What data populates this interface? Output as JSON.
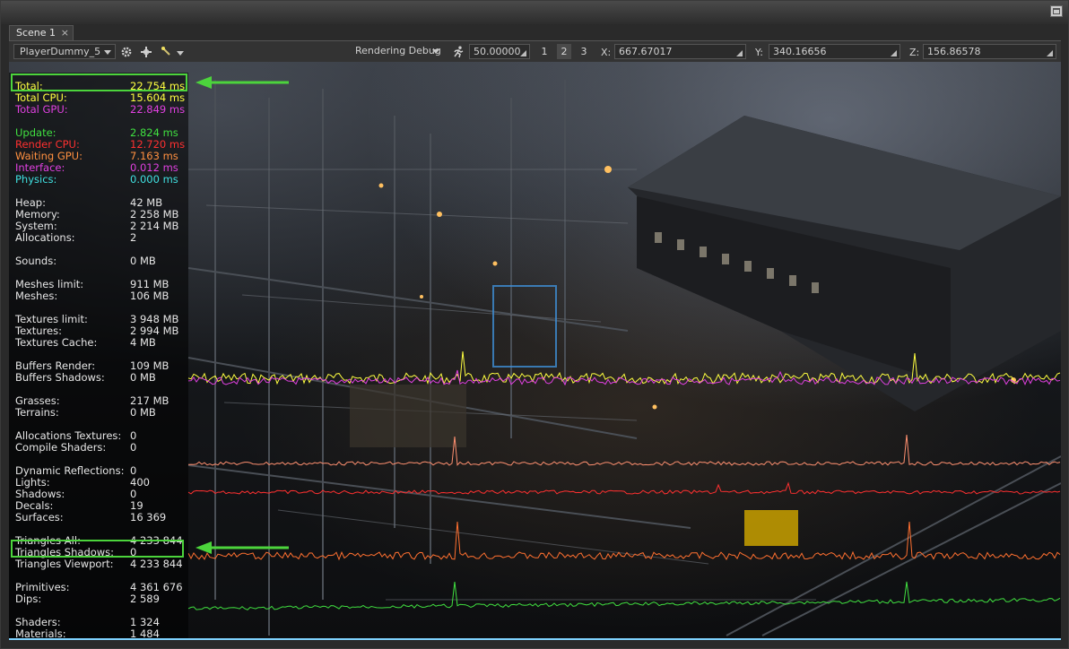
{
  "tab": {
    "label": "Scene 1",
    "close": "×"
  },
  "toolbar": {
    "camera_combo": "PlayerDummy_5",
    "mode_combo": "Rendering Debug",
    "speed_value": "50.00000",
    "view_buttons": [
      "1",
      "2",
      "3"
    ],
    "x_label": "X:",
    "x_value": "667.67017",
    "y_label": "Y:",
    "y_value": "340.16656",
    "z_label": "Z:",
    "z_value": "156.86578"
  },
  "stats": [
    {
      "label": "Total:",
      "value": "22.754 ms",
      "color": "#ffff40"
    },
    {
      "label": "Total CPU:",
      "value": "15.604 ms",
      "color": "#ffff40"
    },
    {
      "label": "Total GPU:",
      "value": "22.849 ms",
      "color": "#e040e0"
    },
    {
      "label": "Update:",
      "value": "2.824 ms",
      "color": "#40e040"
    },
    {
      "label": "Render CPU:",
      "value": "12.720 ms",
      "color": "#ff3030"
    },
    {
      "label": "Waiting GPU:",
      "value": "7.163 ms",
      "color": "#ff9040"
    },
    {
      "label": "Interface:",
      "value": "0.012 ms",
      "color": "#e040e0"
    },
    {
      "label": "Physics:",
      "value": "0.000 ms",
      "color": "#40e0e0"
    },
    {
      "label": "Heap:",
      "value": "42 MB",
      "color": "#e6e6e6"
    },
    {
      "label": "Memory:",
      "value": "2 258 MB",
      "color": "#e6e6e6"
    },
    {
      "label": "System:",
      "value": "2 214 MB",
      "color": "#e6e6e6"
    },
    {
      "label": "Allocations:",
      "value": "2",
      "color": "#e6e6e6"
    },
    {
      "label": "Sounds:",
      "value": "0 MB",
      "color": "#e6e6e6"
    },
    {
      "label": "Meshes limit:",
      "value": "911 MB",
      "color": "#e6e6e6"
    },
    {
      "label": "Meshes:",
      "value": "106 MB",
      "color": "#e6e6e6"
    },
    {
      "label": "Textures limit:",
      "value": "3 948 MB",
      "color": "#e6e6e6"
    },
    {
      "label": "Textures:",
      "value": "2 994 MB",
      "color": "#e6e6e6"
    },
    {
      "label": "Textures Cache:",
      "value": "4 MB",
      "color": "#e6e6e6"
    },
    {
      "label": "Buffers Render:",
      "value": "109 MB",
      "color": "#e6e6e6"
    },
    {
      "label": "Buffers Shadows:",
      "value": "0 MB",
      "color": "#e6e6e6"
    },
    {
      "label": "Grasses:",
      "value": "217 MB",
      "color": "#e6e6e6"
    },
    {
      "label": "Terrains:",
      "value": "0 MB",
      "color": "#e6e6e6"
    },
    {
      "label": "Allocations Textures:",
      "value": "0",
      "color": "#e6e6e6"
    },
    {
      "label": "Compile Shaders:",
      "value": "0",
      "color": "#e6e6e6"
    },
    {
      "label": "Dynamic Reflections:",
      "value": "0",
      "color": "#e6e6e6"
    },
    {
      "label": "Lights:",
      "value": "400",
      "color": "#e6e6e6"
    },
    {
      "label": "Shadows:",
      "value": "0",
      "color": "#e6e6e6"
    },
    {
      "label": "Decals:",
      "value": "19",
      "color": "#e6e6e6"
    },
    {
      "label": "Surfaces:",
      "value": "16 369",
      "color": "#e6e6e6"
    },
    {
      "label": "Triangles All:",
      "value": "4 233 844",
      "color": "#e6e6e6"
    },
    {
      "label": "Triangles Shadows:",
      "value": "0",
      "color": "#e6e6e6"
    },
    {
      "label": "Triangles Viewport:",
      "value": "4 233 844",
      "color": "#e6e6e6"
    },
    {
      "label": "Primitives:",
      "value": "4 361 676",
      "color": "#e6e6e6"
    },
    {
      "label": "Dips:",
      "value": "2 589",
      "color": "#e6e6e6"
    },
    {
      "label": "Shaders:",
      "value": "1 324",
      "color": "#e6e6e6"
    },
    {
      "label": "Materials:",
      "value": "1 484",
      "color": "#e6e6e6"
    }
  ],
  "colors": {
    "highlight": "#4cd43c",
    "viewport_border": "#7fd3ff"
  },
  "graph_colors": [
    "#ffff40",
    "#e040e0",
    "#ff9070",
    "#ff3030",
    "#ff7030",
    "#40e040"
  ],
  "icons": [
    "gear-icon",
    "move-icon",
    "wand-icon",
    "running-man-icon",
    "maximize-icon",
    "arrow-left-icon"
  ]
}
